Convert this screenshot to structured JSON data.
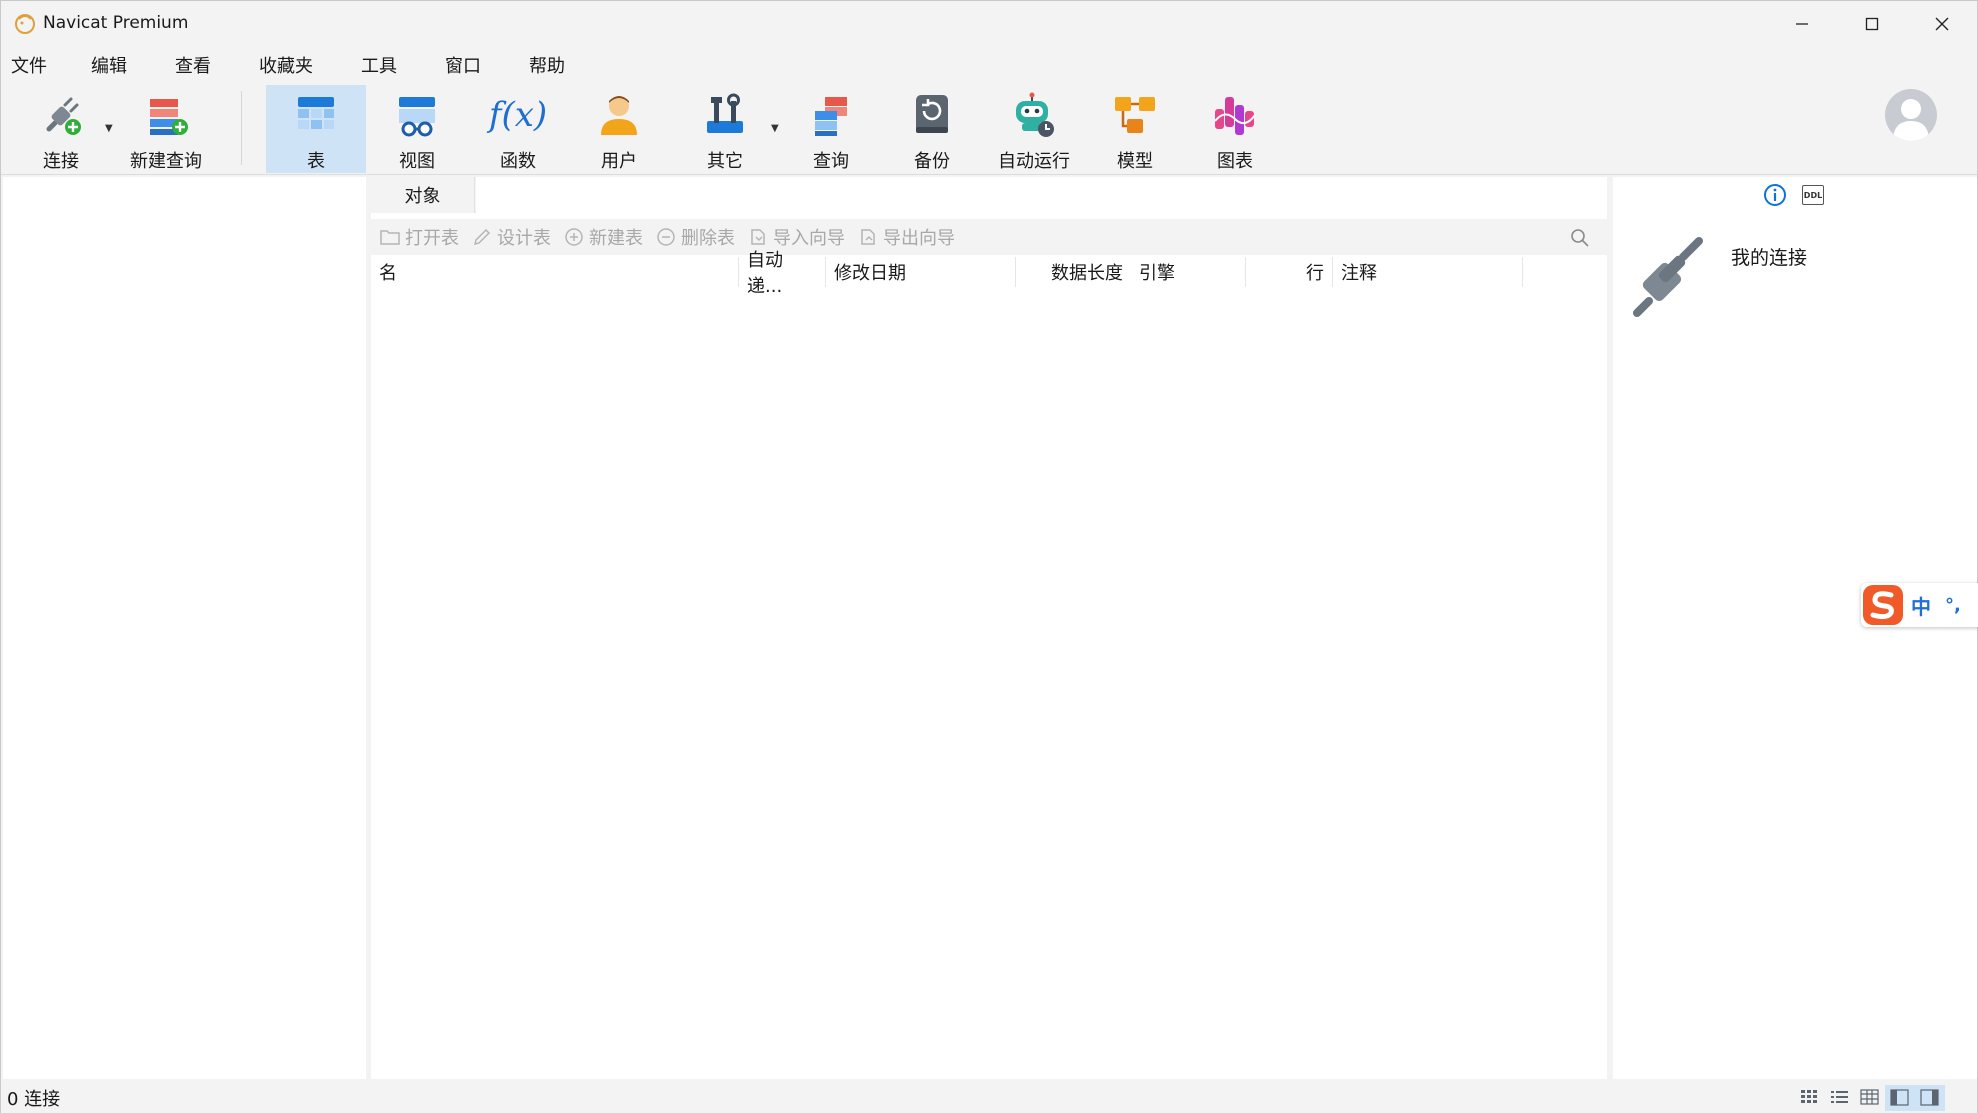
{
  "window": {
    "title": "Navicat Premium",
    "controls": {
      "minimize": "—",
      "maximize": "☐",
      "close": "✕"
    }
  },
  "menu": [
    "文件",
    "编辑",
    "查看",
    "收藏夹",
    "工具",
    "窗口",
    "帮助"
  ],
  "toolbar": {
    "items": [
      {
        "label": "连接",
        "icon": "plug-add-icon"
      },
      {
        "label": "新建查询",
        "icon": "new-query-icon"
      },
      {
        "label": "表",
        "icon": "table-icon",
        "active": true
      },
      {
        "label": "视图",
        "icon": "view-icon"
      },
      {
        "label": "函数",
        "icon": "function-icon",
        "glyph": "f(x)"
      },
      {
        "label": "用户",
        "icon": "user-icon"
      },
      {
        "label": "其它",
        "icon": "tools-icon"
      },
      {
        "label": "查询",
        "icon": "query-icon"
      },
      {
        "label": "备份",
        "icon": "backup-icon"
      },
      {
        "label": "自动运行",
        "icon": "robot-icon"
      },
      {
        "label": "模型",
        "icon": "model-icon"
      },
      {
        "label": "图表",
        "icon": "chart-icon"
      }
    ]
  },
  "center": {
    "tab_label": "对象",
    "object_actions": [
      "打开表",
      "设计表",
      "新建表",
      "删除表",
      "导入向导",
      "导出向导"
    ],
    "columns": [
      "名",
      "自动递...",
      "修改日期",
      "数据长度",
      "引擎",
      "行",
      "注释"
    ]
  },
  "right": {
    "connection_title": "我的连接"
  },
  "ime": {
    "mode": "中",
    "punct": "°,"
  },
  "status": {
    "text": "0 连接"
  },
  "colors": {
    "accent": "#0a74d6",
    "active_bg": "#cfe3f7"
  }
}
